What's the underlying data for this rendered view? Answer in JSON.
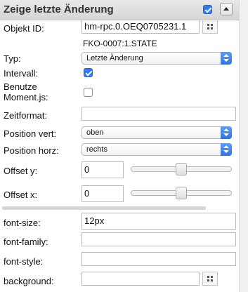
{
  "header": {
    "title": "Zeige letzte Änderung",
    "enabled": true
  },
  "fields": {
    "objekt_id": {
      "label": "Objekt ID:",
      "value": "hm-rpc.0.OEQ0705231.1",
      "sub": "FKO-0007:1.STATE"
    },
    "typ": {
      "label": "Typ:",
      "value": "Letzte Änderung"
    },
    "intervall": {
      "label": "Intervall:",
      "checked": true
    },
    "moment": {
      "label_line1": "Benutze",
      "label_line2": "Moment.js:",
      "checked": false
    },
    "zeitformat": {
      "label": "Zeitformat:",
      "value": ""
    },
    "position_vert": {
      "label": "Position vert:",
      "value": "oben"
    },
    "position_horz": {
      "label": "Position horz:",
      "value": "rechts"
    },
    "offset_y": {
      "label": "Offset y:",
      "value": "0",
      "slider_fraction": 0.5
    },
    "offset_x": {
      "label": "Offset x:",
      "value": "0",
      "slider_fraction": 0.5
    }
  },
  "css": {
    "font_size": {
      "label": "font-size:",
      "value": "12px"
    },
    "font_family": {
      "label": "font-family:",
      "value": ""
    },
    "font_style": {
      "label": "font-style:",
      "value": ""
    },
    "background": {
      "label": "background:",
      "value": ""
    }
  },
  "icons": {
    "collapse": "chevron-up-icon",
    "object_picker": "grid-icon",
    "color_picker": "grid-icon"
  },
  "colors": {
    "accent": "#2d7cf6",
    "header_bg": "#dcdcdc"
  }
}
